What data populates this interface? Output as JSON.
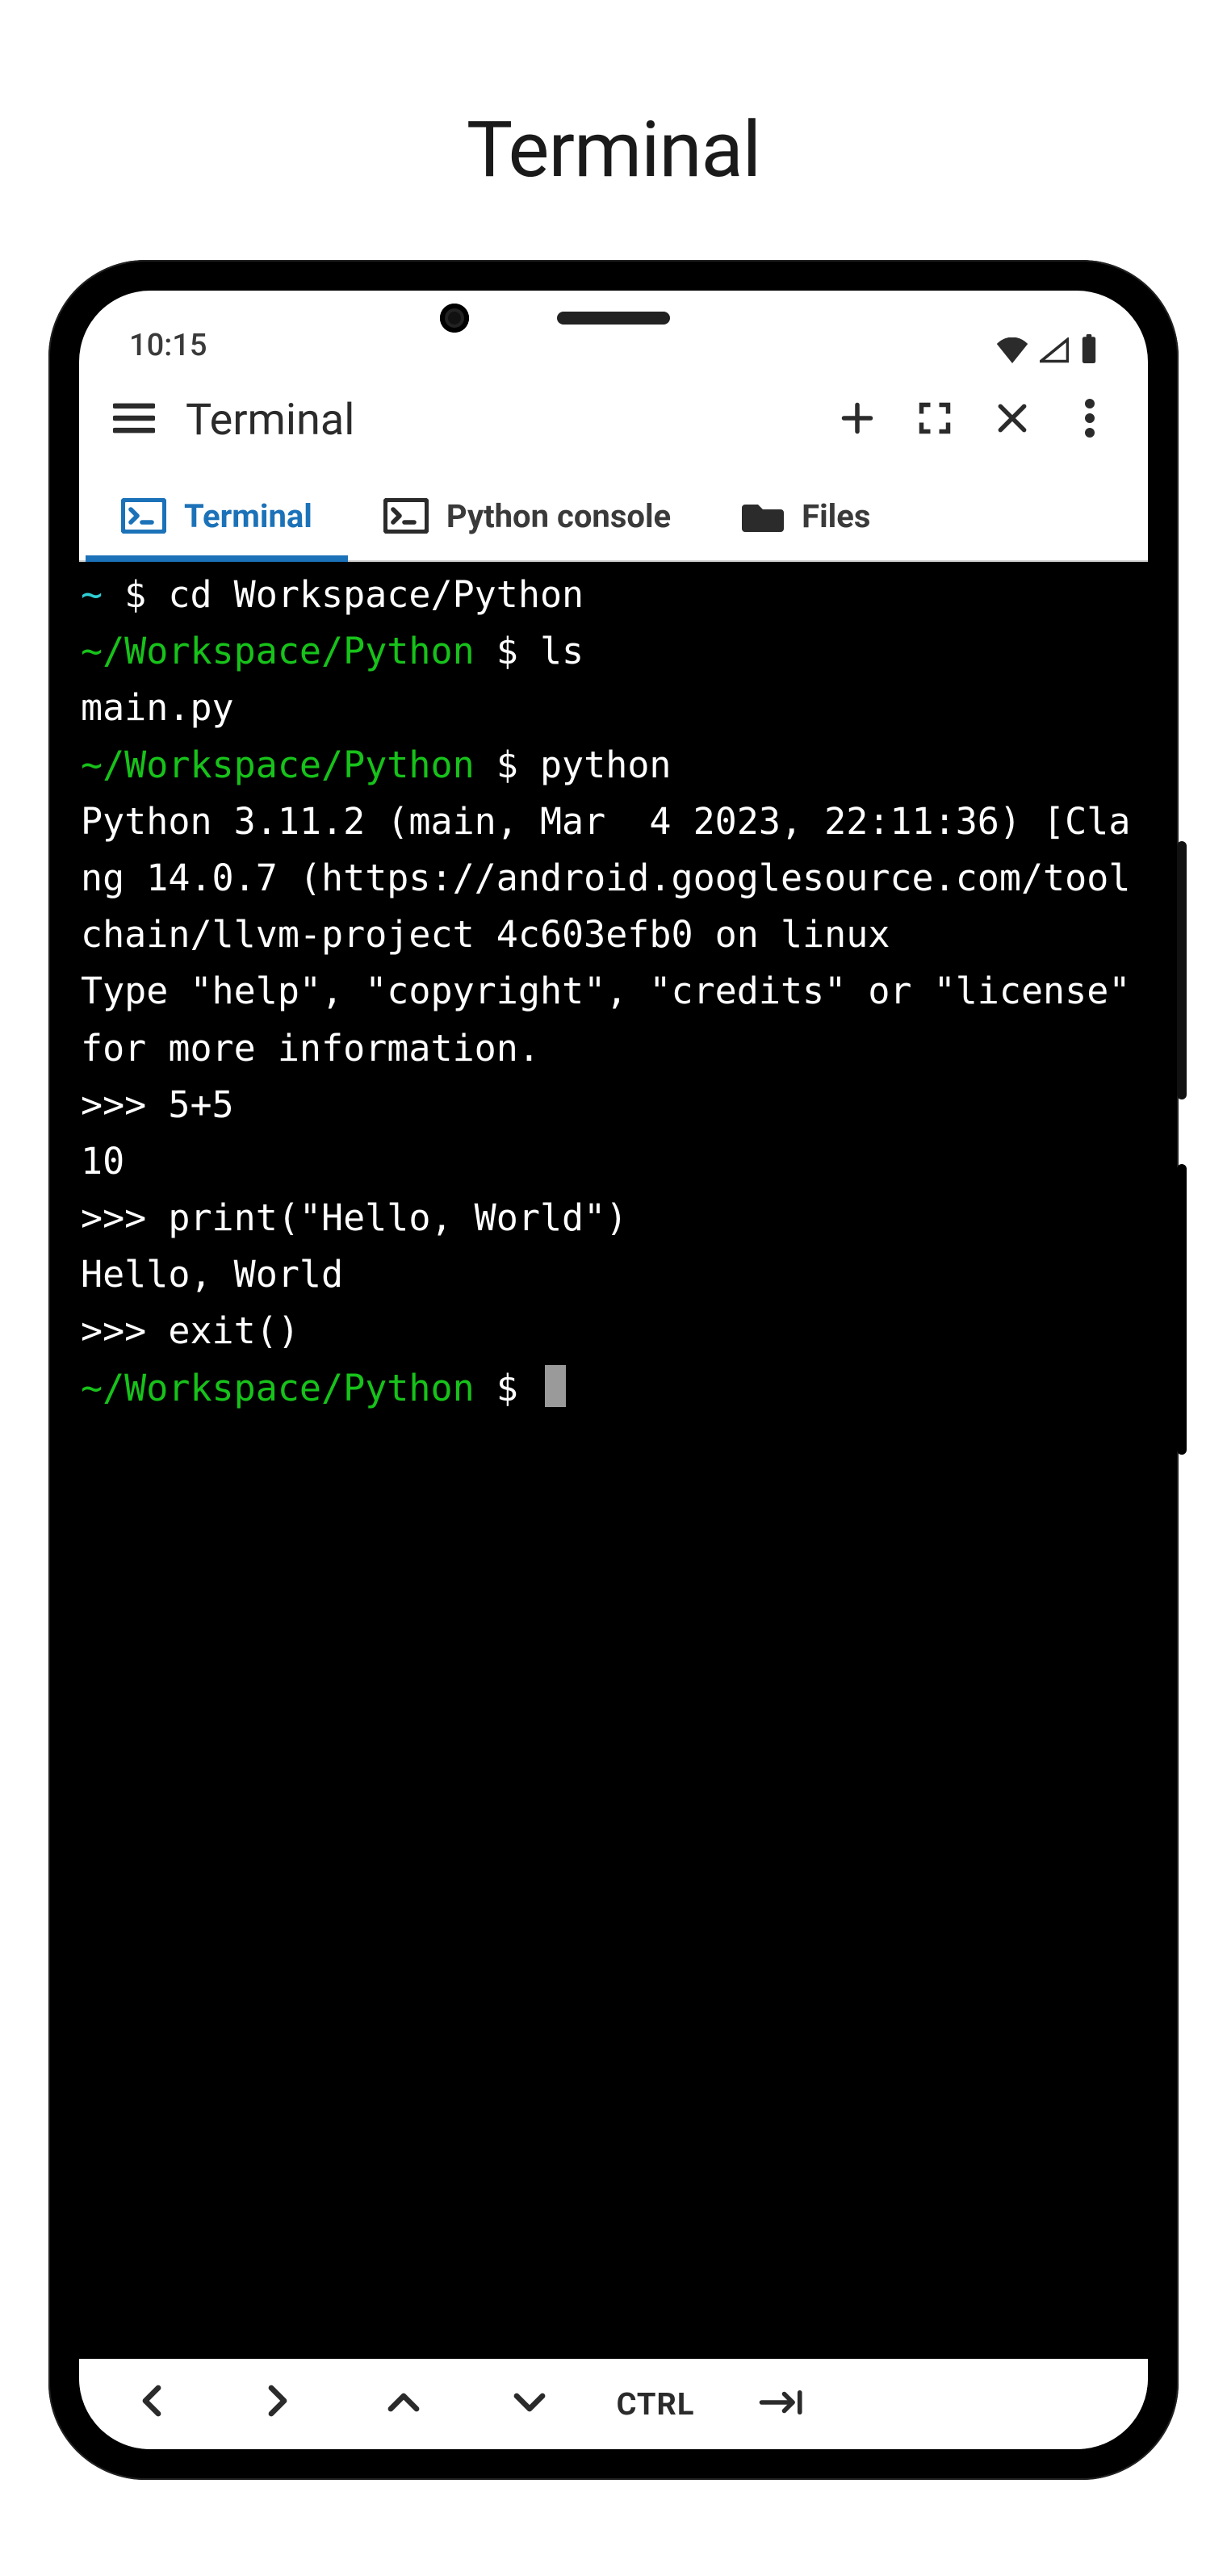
{
  "page": {
    "heading": "Terminal"
  },
  "status": {
    "time": "10:15"
  },
  "appbar": {
    "title": "Terminal"
  },
  "tabs": [
    {
      "label": "Terminal",
      "active": true
    },
    {
      "label": "Python console",
      "active": false
    },
    {
      "label": "Files",
      "active": false
    }
  ],
  "keys": {
    "ctrl": "CTRL"
  },
  "colors": {
    "accent": "#1c72b8",
    "term_bg": "#000000",
    "term_fg": "#ffffff",
    "term_path": "#17c21a",
    "term_tilde": "#2ecfd4"
  },
  "session": {
    "lines": [
      {
        "segments": [
          {
            "text": "~",
            "c": "cyan"
          },
          {
            "text": " $ cd Workspace/Python",
            "c": "white"
          }
        ]
      },
      {
        "segments": [
          {
            "text": "~/Workspace/Python",
            "c": "green"
          },
          {
            "text": " $ ls",
            "c": "white"
          }
        ]
      },
      {
        "segments": [
          {
            "text": "main.py",
            "c": "white"
          }
        ]
      },
      {
        "segments": [
          {
            "text": "~/Workspace/Python",
            "c": "green"
          },
          {
            "text": " $ python",
            "c": "white"
          }
        ]
      },
      {
        "segments": [
          {
            "text": "Python 3.11.2 (main, Mar  4 2023, 22:11:36) [Clang 14.0.7 (https://android.googlesource.com/toolchain/llvm-project 4c603efb0 on linux",
            "c": "white"
          }
        ]
      },
      {
        "segments": [
          {
            "text": "Type \"help\", \"copyright\", \"credits\" or \"license\" for more information.",
            "c": "white"
          }
        ]
      },
      {
        "segments": [
          {
            "text": ">>> 5+5",
            "c": "white"
          }
        ]
      },
      {
        "segments": [
          {
            "text": "10",
            "c": "white"
          }
        ]
      },
      {
        "segments": [
          {
            "text": ">>> print(\"Hello, World\")",
            "c": "white"
          }
        ]
      },
      {
        "segments": [
          {
            "text": "Hello, World",
            "c": "white"
          }
        ]
      },
      {
        "segments": [
          {
            "text": ">>> exit()",
            "c": "white"
          }
        ]
      },
      {
        "segments": [
          {
            "text": "~/Workspace/Python",
            "c": "green"
          },
          {
            "text": " $ ",
            "c": "white"
          }
        ],
        "cursor": true
      }
    ]
  }
}
